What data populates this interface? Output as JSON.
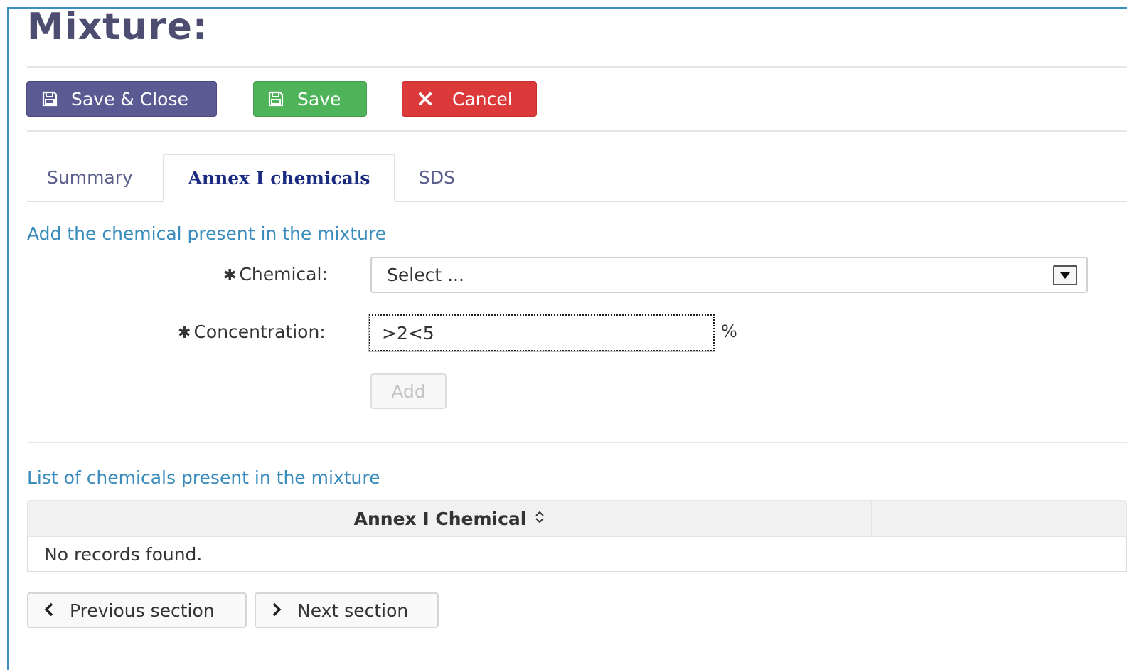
{
  "page": {
    "title": "Mixture:"
  },
  "toolbar": {
    "save_close_label": "Save & Close",
    "save_label": "Save",
    "cancel_label": "Cancel"
  },
  "tabs": [
    {
      "label": "Summary",
      "active": false
    },
    {
      "label": "Annex I chemicals",
      "active": true
    },
    {
      "label": "SDS",
      "active": false
    }
  ],
  "add_section": {
    "title": "Add the chemical present in the mixture",
    "chemical_label": "Chemical:",
    "chemical_value": "Select ...",
    "concentration_label": "Concentration:",
    "concentration_value": ">2<5",
    "unit": "%",
    "add_label": "Add"
  },
  "list_section": {
    "title": "List of chemicals present in the mixture",
    "columns": [
      "Annex I Chemical",
      ""
    ],
    "empty_message": "No records found."
  },
  "navigation": {
    "previous_label": "Previous section",
    "next_label": "Next section"
  },
  "icons": {
    "save": "floppy-disk-icon",
    "cancel": "x-icon",
    "sort": "sort-updown-icon",
    "dropdown": "dropdown-arrow-icon",
    "previous": "chevron-left-icon",
    "next": "chevron-right-icon"
  },
  "colors": {
    "save_close": "#5b5a93",
    "save": "#4fb35a",
    "cancel": "#dc3a3a",
    "section_title": "#3a8cbc",
    "active_tab": "#1a2a80"
  }
}
